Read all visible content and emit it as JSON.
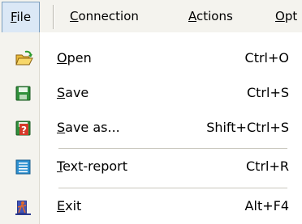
{
  "menubar": {
    "items": [
      {
        "label": "File"
      },
      {
        "label": "Connection"
      },
      {
        "label": "Actions"
      },
      {
        "label": "Opt"
      }
    ]
  },
  "file_menu": {
    "items": [
      {
        "label": "Open",
        "shortcut": "Ctrl+O",
        "icon": "open-folder-icon"
      },
      {
        "label": "Save",
        "shortcut": "Ctrl+S",
        "icon": "save-icon"
      },
      {
        "label": "Save as...",
        "shortcut": "Shift+Ctrl+S",
        "icon": "save-as-icon"
      },
      {
        "label": "Text-report",
        "shortcut": "Ctrl+R",
        "icon": "text-report-icon"
      },
      {
        "label": "Exit",
        "shortcut": "Alt+F4",
        "icon": "exit-door-icon"
      }
    ]
  },
  "colors": {
    "menubar_bg": "#f4f3ee",
    "active_menu_bg": "#dbe8f6",
    "active_menu_border": "#7b9ebd",
    "icon_column_bg": "#f4f3ee"
  }
}
